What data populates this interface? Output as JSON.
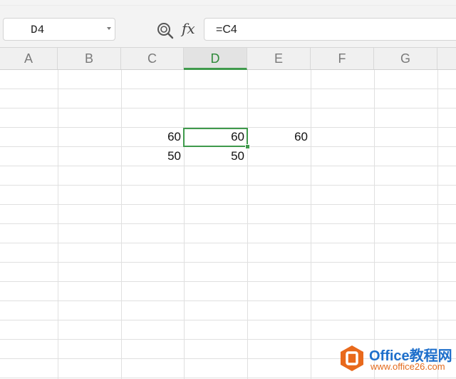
{
  "name_box": {
    "value": "D4"
  },
  "formula_bar": {
    "formula": "=C4"
  },
  "columns": [
    "A",
    "B",
    "C",
    "D",
    "E",
    "F",
    "G"
  ],
  "active_column": "D",
  "cells": {
    "C4": "60",
    "D4": "60",
    "E4": "60",
    "C5": "50",
    "D5": "50"
  },
  "watermark": {
    "title": "Office教程网",
    "url": "www.office26.com"
  },
  "colors": {
    "accent": "#3f9a4c",
    "watermark_blue": "#1e6fcb",
    "watermark_orange": "#e36b1e"
  }
}
